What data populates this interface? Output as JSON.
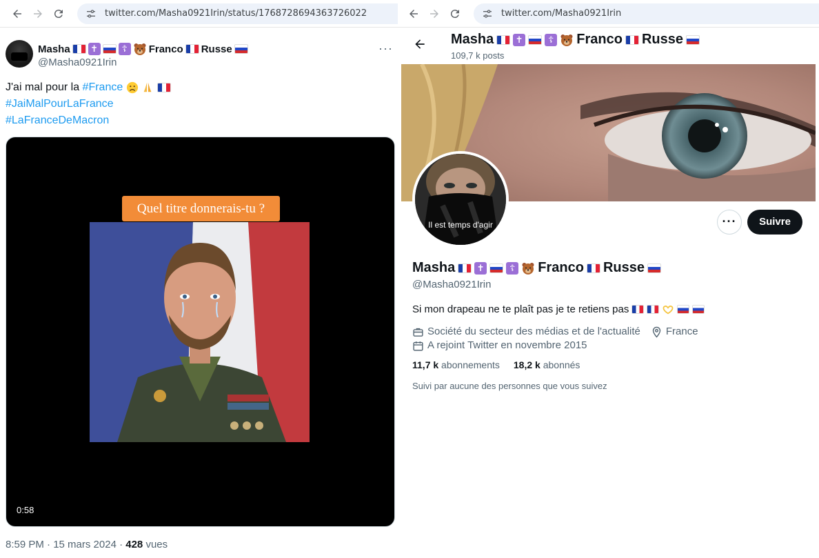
{
  "left": {
    "url": "twitter.com/Masha0921Irin/status/1768728694363726022",
    "author_name_a": "Masha",
    "author_name_b": "Franco",
    "author_name_c": "Russe",
    "author_handle": "@Masha0921Irin",
    "more_label": "···",
    "avatar_text": "Il est temps d'agir",
    "tweet_line1_prefix": "J'ai mal pour la ",
    "tweet_hashtag1": "#France",
    "tweet_hashtag2": "#JaiMalPourLaFrance",
    "tweet_hashtag3": "#LaFranceDeMacron",
    "video_caption": "Quel titre donnerais-tu ?",
    "video_time": "0:58",
    "meta_time": "8:59 PM · 15 mars 2024 · ",
    "meta_views_count": "428",
    "meta_views_label": " vues"
  },
  "right": {
    "url": "twitter.com/Masha0921Irin",
    "header_name_a": "Masha",
    "header_name_b": "Franco",
    "header_name_c": "Russe",
    "post_count": "109,7 k posts",
    "avatar_text": "Il est temps d'agir",
    "more_label": "···",
    "follow_label": "Suivre",
    "name_a": "Masha",
    "name_b": "Franco",
    "name_c": "Russe",
    "handle": "@Masha0921Irin",
    "bio": "Si mon drapeau ne te plaît pas je te retiens pas",
    "category": "Société du secteur des médias et de l'actualité",
    "location": "France",
    "joined": "A rejoint Twitter en novembre 2015",
    "following_count": "11,7 k",
    "following_label": "abonnements",
    "followers_count": "18,2 k",
    "followers_label": "abonnés",
    "followed_by": "Suivi par aucune des personnes que vous suivez"
  },
  "colors": {
    "link": "#1d9bf0",
    "follow_button": "#0f1419",
    "caption_bg": "#f28c38",
    "muted": "#536471"
  },
  "icons": [
    "back-arrow-icon",
    "forward-arrow-icon",
    "reload-icon",
    "site-settings-icon",
    "briefcase-icon",
    "location-pin-icon",
    "calendar-icon",
    "more-icon"
  ]
}
